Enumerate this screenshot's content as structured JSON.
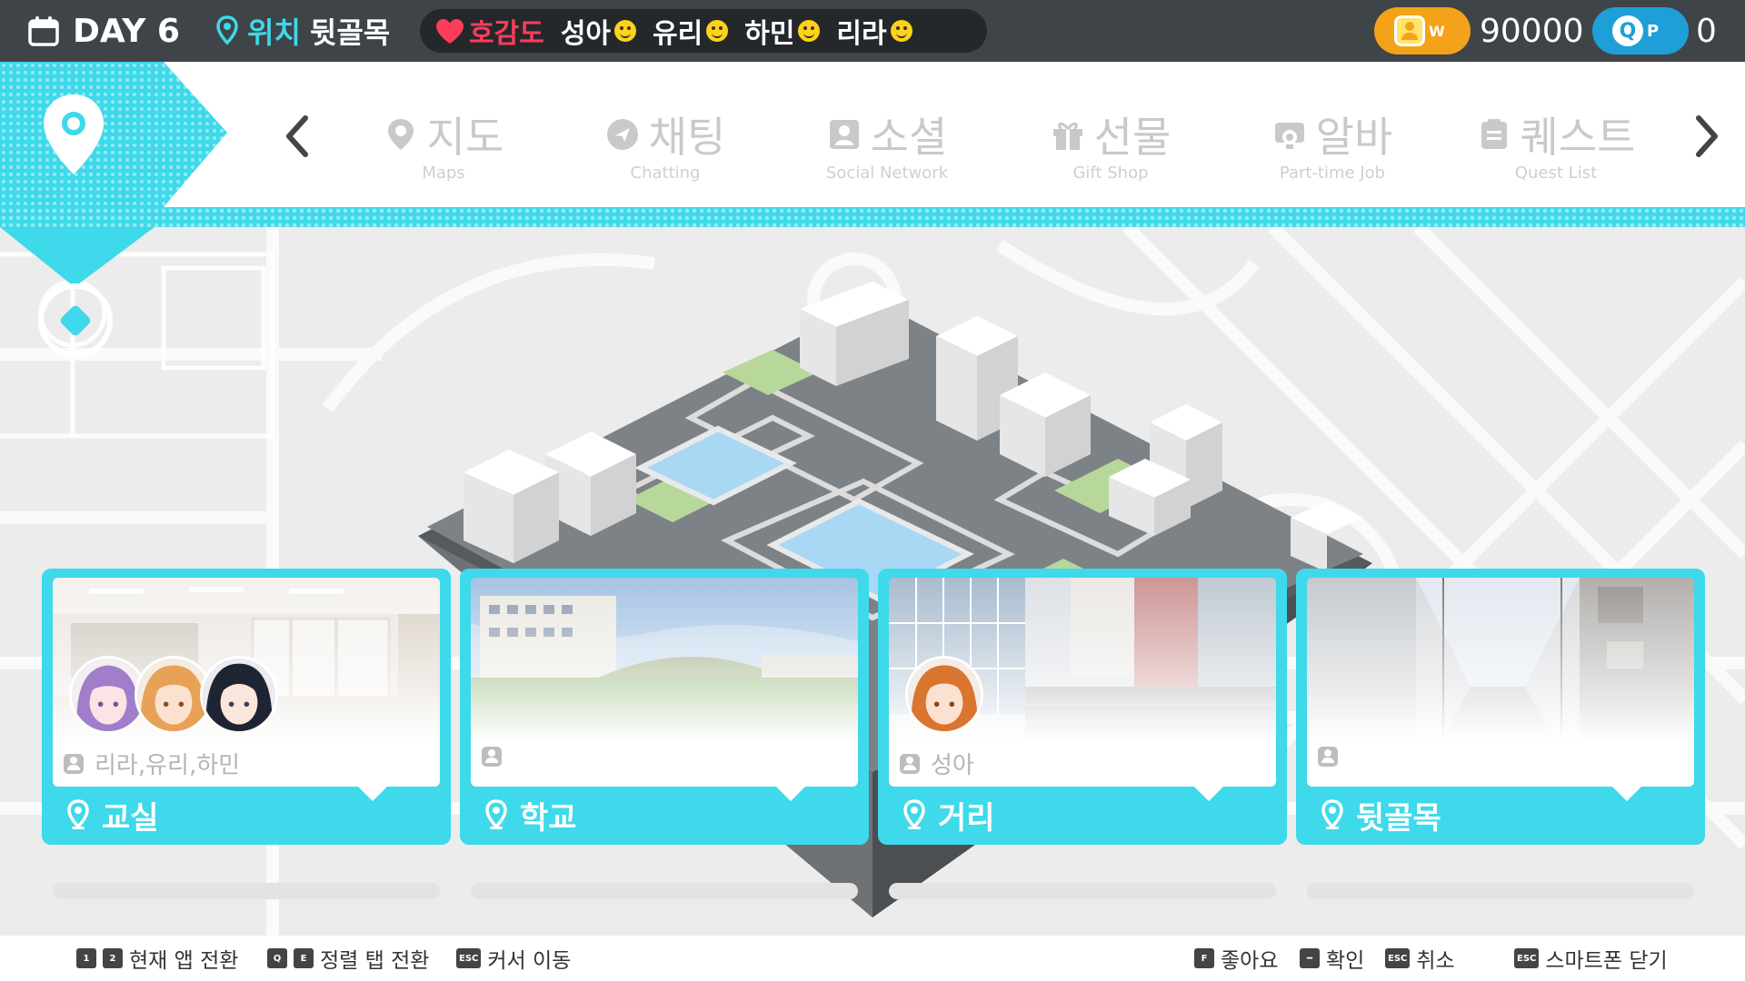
{
  "topbar": {
    "day_label": "DAY 6",
    "location_label": "위치",
    "location_value": "뒷골목",
    "affinity_label": "호감도",
    "characters": [
      "성아",
      "유리",
      "하민",
      "리라"
    ],
    "won_symbol": "W",
    "money": "90000",
    "qp_q": "Q",
    "qp_p": "P",
    "qp_value": "0"
  },
  "nav": {
    "items": [
      {
        "ko": "지도",
        "en": "Maps",
        "icon": "map-pin-icon"
      },
      {
        "ko": "채팅",
        "en": "Chatting",
        "icon": "chat-icon"
      },
      {
        "ko": "소셜",
        "en": "Social Network",
        "icon": "social-icon"
      },
      {
        "ko": "선물",
        "en": "Gift Shop",
        "icon": "gift-icon"
      },
      {
        "ko": "알바",
        "en": "Part-time Job",
        "icon": "job-icon"
      },
      {
        "ko": "퀘스트",
        "en": "Quest List",
        "icon": "quest-icon"
      }
    ]
  },
  "locations": [
    {
      "name": "교실",
      "characters": "리라,유리,하민"
    },
    {
      "name": "학교",
      "characters": ""
    },
    {
      "name": "거리",
      "characters": "성아"
    },
    {
      "name": "뒷골목",
      "characters": ""
    }
  ],
  "hints": {
    "switch_app": "현재 앱 전환",
    "switch_tab": "정렬 탭 전환",
    "move_cursor": "커서 이동",
    "like": "좋아요",
    "confirm": "확인",
    "cancel": "취소",
    "close_phone": "스마트폰 닫기",
    "keys": {
      "k1": "1",
      "k2": "2",
      "kq": "Q",
      "ke": "E",
      "kesc": "ESC",
      "kf": "F"
    }
  },
  "colors": {
    "accent": "#3ed9ea",
    "topbar": "#3f4448",
    "heart": "#ff3c5a",
    "won": "#f5a21b",
    "qp": "#1f9fd8"
  }
}
